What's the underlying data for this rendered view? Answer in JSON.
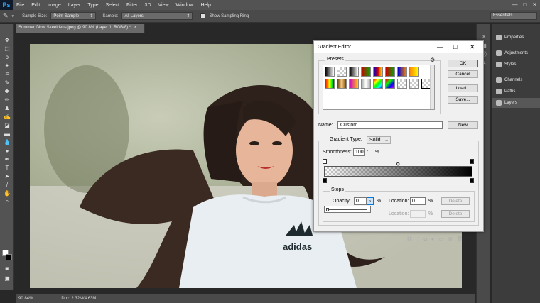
{
  "app": {
    "logo": "Ps"
  },
  "menu": [
    "File",
    "Edit",
    "Image",
    "Layer",
    "Type",
    "Select",
    "Filter",
    "3D",
    "View",
    "Window",
    "Help"
  ],
  "window_controls": {
    "minimize": "—",
    "maximize": "□",
    "close": "✕"
  },
  "options_bar": {
    "sample_size_label": "Sample Size:",
    "sample_size_value": "Point Sample",
    "sample_label": "Sample:",
    "sample_value": "All Layers",
    "show_ring_label": "Show Sampling Ring",
    "workspace": "Essentials"
  },
  "document": {
    "tab_title": "Summer Glow Skeeldens.jpeg @ 90.8% (Layer 1, RGB/8) *",
    "tab_close": "×",
    "zoom": "90.84%",
    "doc_size": "Doc: 2.32M/4.63M"
  },
  "right_panel": {
    "items": [
      "Properties",
      "Adjustments",
      "Styles",
      "Channels",
      "Paths",
      "Layers"
    ]
  },
  "gradient_editor": {
    "title": "Gradient Editor",
    "presets_label": "Presets",
    "buttons": {
      "ok": "OK",
      "cancel": "Cancel",
      "load": "Load...",
      "save": "Save...",
      "new": "New"
    },
    "name_label": "Name:",
    "name_value": "Custom",
    "gradient_type_label": "Gradient Type:",
    "gradient_type_value": "Solid",
    "smoothness_label": "Smoothness:",
    "smoothness_value": "100",
    "smoothness_unit": "%",
    "stops_label": "Stops",
    "opacity_label": "Opacity:",
    "opacity_value": "0",
    "opacity_unit": "%",
    "location_label": "Location:",
    "location_value": "0",
    "location_unit": "%",
    "delete_label": "Delete",
    "color_location_label": "Location:",
    "color_location_unit": "%",
    "color_delete_label": "Delete"
  }
}
